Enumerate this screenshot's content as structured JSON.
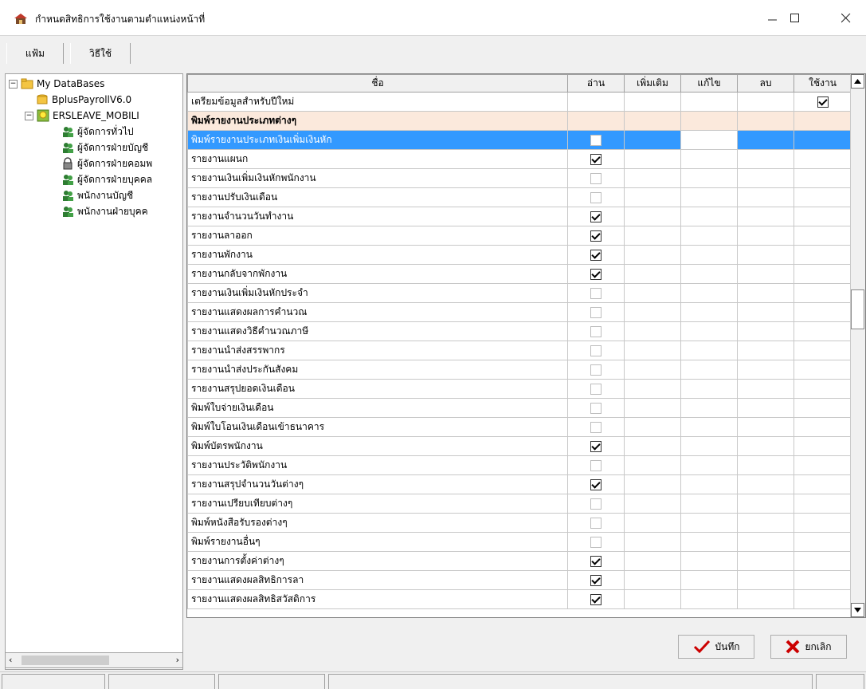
{
  "window": {
    "title": "กำหนดสิทธิการใช้งานตามตำแหน่งหน้าที่"
  },
  "menu": {
    "file": "แฟ้ม",
    "howto": "วิธีใช้"
  },
  "tree": {
    "root": "My DataBases",
    "db1": "BplusPayrollV6.0",
    "db2": "ERSLEAVE_MOBILI",
    "roles": [
      "ผู้จัดการทั่วไป",
      "ผู้จัดการฝ่ายบัญชี",
      "ผู้จัดการฝ่ายคอมพ",
      "ผู้จัดการฝ่ายบุคคล",
      "พนักงานบัญชี",
      "พนักงานฝ่ายบุคค"
    ]
  },
  "grid": {
    "headers": {
      "name": "ชื่อ",
      "read": "อ่าน",
      "add": "เพิ่มเติม",
      "edit": "แก้ไข",
      "delete": "ลบ",
      "use": "ใช้งาน"
    },
    "rows": [
      {
        "name": "เตรียมข้อมูลสำหรับปีใหม่",
        "type": "use",
        "use": true
      },
      {
        "name": "พิมพ์รายงานประเภทต่างๆ",
        "type": "group"
      },
      {
        "name": "พิมพ์รายงานประเภทเงินเพิ่มเงินหัก",
        "type": "read",
        "read": false,
        "selected": true
      },
      {
        "name": "รายงานแผนก",
        "type": "read",
        "read": true
      },
      {
        "name": "รายงานเงินเพิ่มเงินหักพนักงาน",
        "type": "read",
        "read": false
      },
      {
        "name": "รายงานปรับเงินเดือน",
        "type": "read",
        "read": false
      },
      {
        "name": "รายงานจำนวนวันทำงาน",
        "type": "read",
        "read": true
      },
      {
        "name": "รายงานลาออก",
        "type": "read",
        "read": true
      },
      {
        "name": "รายงานพักงาน",
        "type": "read",
        "read": true
      },
      {
        "name": "รายงานกลับจากพักงาน",
        "type": "read",
        "read": true
      },
      {
        "name": "รายงานเงินเพิ่มเงินหักประจำ",
        "type": "read",
        "read": false
      },
      {
        "name": "รายงานแสดงผลการคำนวณ",
        "type": "read",
        "read": false
      },
      {
        "name": "รายงานแสดงวิธีคำนวณภาษี",
        "type": "read",
        "read": false
      },
      {
        "name": "รายงานนำส่งสรรพากร",
        "type": "read",
        "read": false
      },
      {
        "name": "รายงานนำส่งประกันสังคม",
        "type": "read",
        "read": false
      },
      {
        "name": "รายงานสรุปยอดเงินเดือน",
        "type": "read",
        "read": false
      },
      {
        "name": "พิมพ์ใบจ่ายเงินเดือน",
        "type": "read",
        "read": false
      },
      {
        "name": "พิมพ์ใบโอนเงินเดือนเข้าธนาคาร",
        "type": "read",
        "read": false
      },
      {
        "name": "พิมพ์บัตรพนักงาน",
        "type": "read",
        "read": true
      },
      {
        "name": "รายงานประวัติพนักงาน",
        "type": "read",
        "read": false
      },
      {
        "name": "รายงานสรุปจำนวนวันต่างๆ",
        "type": "read",
        "read": true
      },
      {
        "name": "รายงานเปรียบเทียบต่างๆ",
        "type": "read",
        "read": false
      },
      {
        "name": "พิมพ์หนังสือรับรองต่างๆ",
        "type": "read",
        "read": false
      },
      {
        "name": "พิมพ์รายงานอื่นๆ",
        "type": "read",
        "read": false
      },
      {
        "name": "รายงานการตั้งค่าต่างๆ",
        "type": "read",
        "read": true
      },
      {
        "name": "รายงานแสดงผลสิทธิการลา",
        "type": "read",
        "read": true
      },
      {
        "name": "รายงานแสดงผลสิทธิสวัสดิการ",
        "type": "read",
        "read": true
      }
    ]
  },
  "buttons": {
    "save": "บันทึก",
    "cancel": "ยกเลิก"
  },
  "colors": {
    "selection": "#3399ff",
    "group_row": "#fbe9dc"
  }
}
